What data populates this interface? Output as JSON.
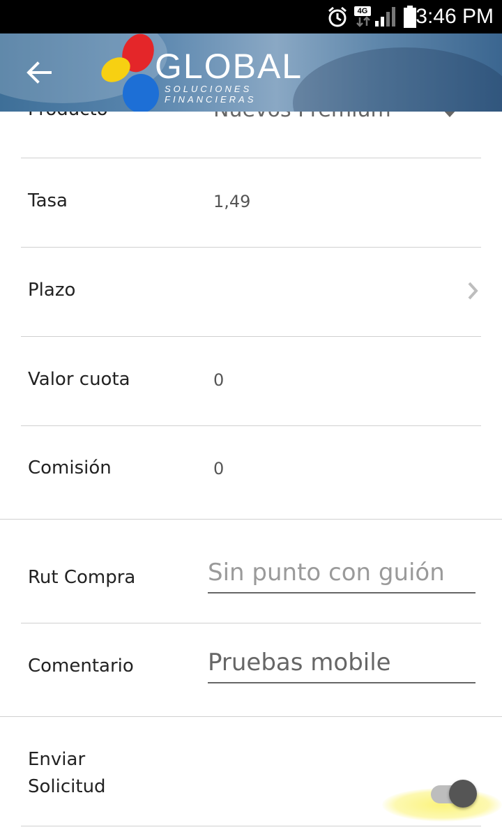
{
  "status_bar": {
    "time": "3:46 PM",
    "network": "4G",
    "icons": [
      "alarm-icon",
      "4g-data-icon",
      "signal-icon",
      "battery-icon"
    ]
  },
  "header": {
    "brand": "GLOBAL",
    "brand_subtitle": "SOLUCIONES FINANCIERAS",
    "back_icon": "arrow-back-icon",
    "logo_colors": {
      "red": "#e42629",
      "yellow": "#f7d012",
      "blue": "#1d6fd6"
    }
  },
  "form": {
    "producto": {
      "label": "Producto",
      "value": "Nuevos Premium"
    },
    "tasa": {
      "label": "Tasa",
      "value": "1,49"
    },
    "plazo": {
      "label": "Plazo",
      "value": ""
    },
    "valor_cuota": {
      "label": "Valor cuota",
      "value": "0"
    },
    "comision": {
      "label": "Comisión",
      "value": "0"
    },
    "rut_compra": {
      "label": "Rut Compra",
      "value": "",
      "placeholder": "Sin punto con guión"
    },
    "comentario": {
      "label": "Comentario",
      "value": "Pruebas mobile"
    },
    "enviar_solicitud": {
      "label_line1": "Enviar",
      "label_line2": "Solicitud",
      "enabled": false
    }
  }
}
